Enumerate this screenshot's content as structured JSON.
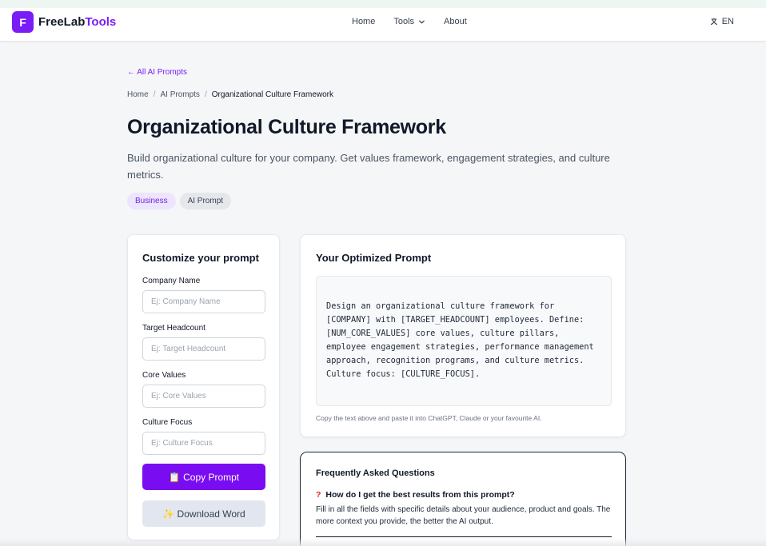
{
  "nav": {
    "logo_letter": "F",
    "brand_main": "FreeLab",
    "brand_accent": "Tools",
    "links": [
      "Home",
      "Tools",
      "About"
    ],
    "language": "EN"
  },
  "page": {
    "back_link": "← All AI Prompts",
    "breadcrumb": [
      "Home",
      "AI Prompts",
      "Organizational Culture Framework"
    ],
    "title": "Organizational Culture Framework",
    "description": "Build organizational culture for your company. Get values framework, engagement strategies, and culture metrics.",
    "tags": [
      "Business",
      "AI Prompt"
    ]
  },
  "form": {
    "title": "Customize your prompt",
    "fields": [
      {
        "label": "Company Name",
        "placeholder": "Ej: Company Name",
        "value": ""
      },
      {
        "label": "Target Headcount",
        "placeholder": "Ej: Target Headcount",
        "value": ""
      },
      {
        "label": "Core Values",
        "placeholder": "Ej: Core Values",
        "value": ""
      },
      {
        "label": "Culture Focus",
        "placeholder": "Ej: Culture Focus",
        "value": ""
      }
    ],
    "copy_button": "📋 Copy Prompt",
    "download_button": "✨ Download Word"
  },
  "prompt": {
    "title": "Your Optimized Prompt",
    "text": "Design an organizational culture framework for [COMPANY] with [TARGET_HEADCOUNT] employees. Define: [NUM_CORE_VALUES] core values, culture pillars, employee engagement strategies, performance management approach, recognition programs, and culture metrics. Culture focus: [CULTURE_FOCUS].",
    "hint": "Copy the text above and paste it into ChatGPT, Claude or your favourite AI."
  },
  "faq": {
    "title": "Frequently Asked Questions",
    "items": [
      {
        "question": "How do I get the best results from this prompt?",
        "answer": "Fill in all the fields with specific details about your audience, product and goals. The more context you provide, the better the AI output."
      }
    ]
  },
  "colors": {
    "brand": "#7a1cf5",
    "primary_button": "#7a0cf2",
    "page_background": "#f5f6f8"
  }
}
